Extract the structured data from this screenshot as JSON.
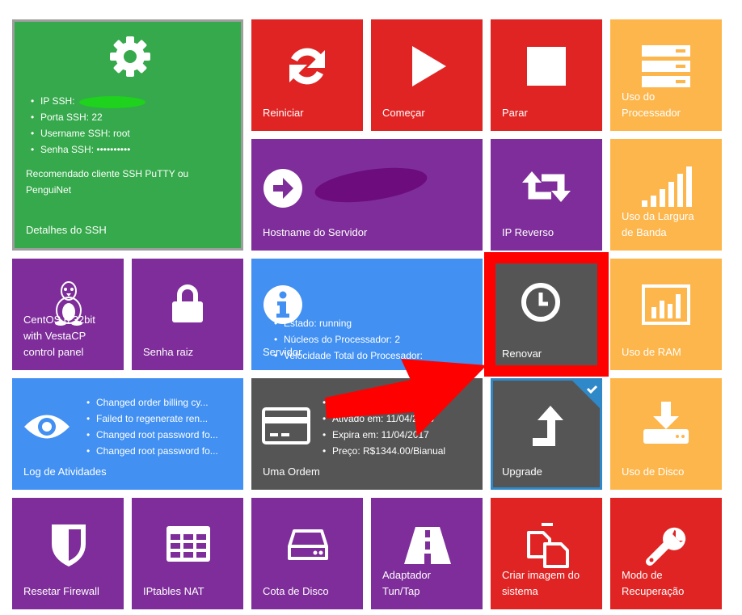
{
  "tiles": {
    "ssh": {
      "label": "Detalhes do SSH",
      "items": [
        "IP SSH:",
        "Porta SSH: 22",
        "Username SSH: root",
        "Senha SSH: ••••••••••"
      ],
      "note": "Recomendado cliente SSH PuTTY ou PenguiNet",
      "icon": "gear-icon"
    },
    "reiniciar": {
      "label": "Reiniciar",
      "icon": "refresh-icon"
    },
    "comecar": {
      "label": "Começar",
      "icon": "play-icon"
    },
    "parar": {
      "label": "Parar",
      "icon": "stop-icon"
    },
    "cpu": {
      "label": "Uso do\nProcessador",
      "icon": "server-icon"
    },
    "hostname": {
      "label": "Hostname do Servidor",
      "icon": "arrow-circle-icon"
    },
    "ip_reverso": {
      "label": "IP Reverso",
      "icon": "retweet-icon"
    },
    "bandwidth": {
      "label": "Uso da Largura\nde Banda",
      "icon": "signal-bars-icon"
    },
    "os": {
      "label": "CentOS 6 32bit\nwith VestaCP\ncontrol panel",
      "icon": "linux-penguin-icon"
    },
    "senha": {
      "label": "Senha raiz",
      "icon": "lock-icon"
    },
    "servidor": {
      "label": "Servidor",
      "items": [
        "Estado: running",
        "Núcleos do Processador: 2",
        "Velocidade Total do Procesador:"
      ],
      "icon": "info-icon"
    },
    "renovar": {
      "label": "Renovar",
      "icon": "clock-icon"
    },
    "ram": {
      "label": "Uso de RAM",
      "icon": "chart-bars-icon"
    },
    "log": {
      "label": "Log de Atividades",
      "items": [
        "Changed order billing cy...",
        "Failed to regenerate ren...",
        "Changed root password fo...",
        "Changed root password fo..."
      ],
      "icon": "eye-icon"
    },
    "ordem": {
      "label": "Uma Ordem",
      "items": [
        "...2",
        "Ativado em: 11/04/2016",
        "Expira em: 11/04/2017",
        "Preço: R$1344.00/Bianual"
      ],
      "icon": "credit-card-icon"
    },
    "upgrade": {
      "label": "Upgrade",
      "icon": "arrow-up-turn-icon"
    },
    "disco": {
      "label": "Uso de Disco",
      "icon": "download-drive-icon"
    },
    "firewall": {
      "label": "Resetar Firewall",
      "icon": "shield-icon"
    },
    "iptables": {
      "label": "IPtables NAT",
      "icon": "table-icon"
    },
    "cota": {
      "label": "Cota de Disco",
      "icon": "hard-drive-icon"
    },
    "tuntap": {
      "label": "Adaptador\nTun/Tap",
      "icon": "road-icon"
    },
    "imagem": {
      "label": "Criar imagem do\nsistema",
      "icon": "copy-icon"
    },
    "recuperacao": {
      "label": "Modo de\nRecuperação",
      "icon": "wrench-icon"
    }
  },
  "colors": {
    "red": "#e02424",
    "purple": "#7e2d9a",
    "orange": "#fdb64c",
    "green": "#35a94b",
    "blue": "#4190f2",
    "dark": "#555555",
    "highlight": "#ff0000"
  }
}
